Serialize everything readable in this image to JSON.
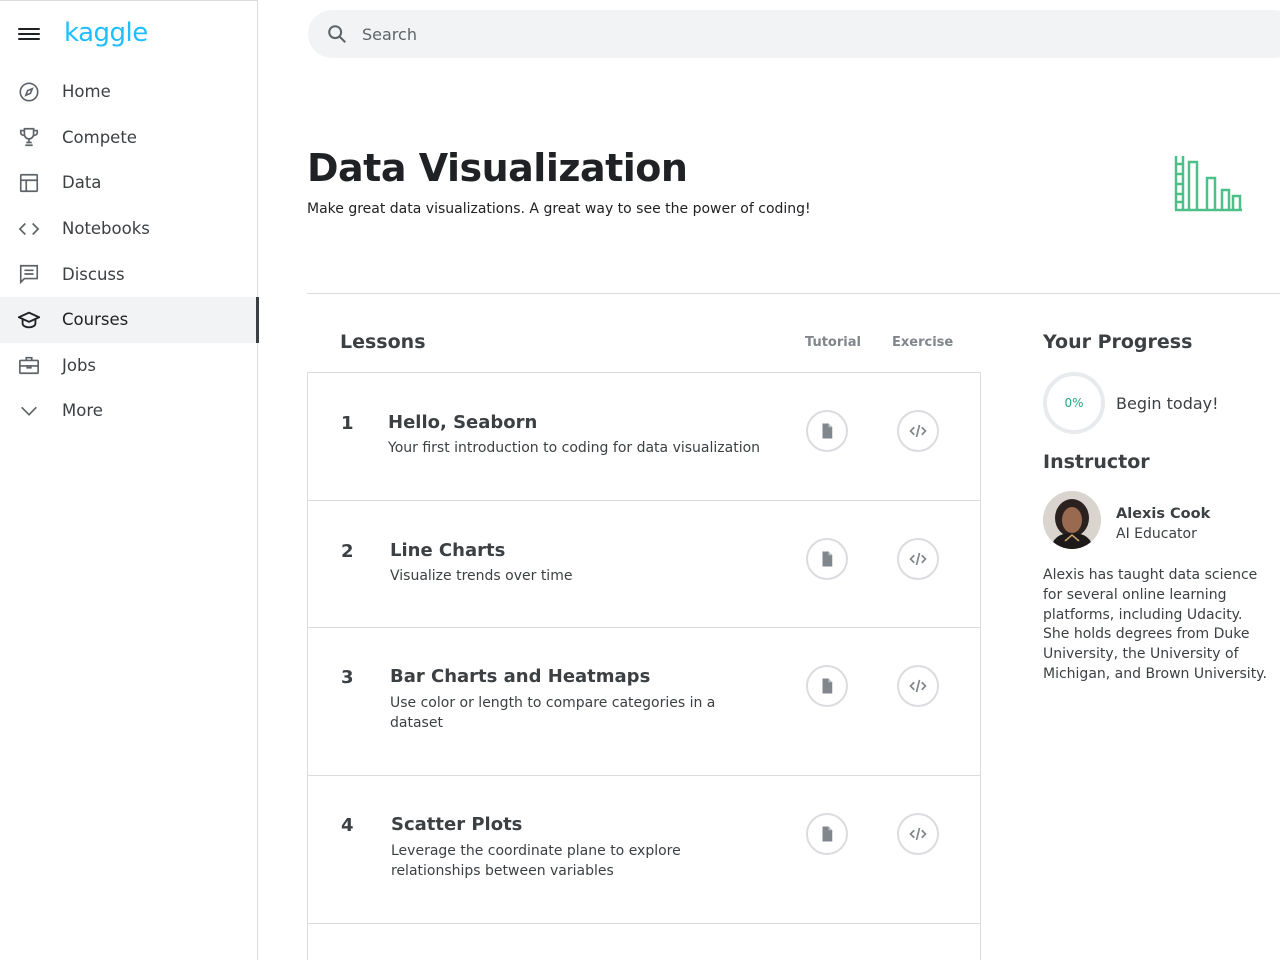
{
  "app": {
    "logo": "kaggle",
    "brand_color": "#20beff",
    "accent_green": "#20a779"
  },
  "sidebar": {
    "items": [
      {
        "label": "Home",
        "icon": "compass-icon",
        "active": false
      },
      {
        "label": "Compete",
        "icon": "trophy-icon",
        "active": false
      },
      {
        "label": "Data",
        "icon": "table-icon",
        "active": false
      },
      {
        "label": "Notebooks",
        "icon": "code-icon",
        "active": false
      },
      {
        "label": "Discuss",
        "icon": "comment-icon",
        "active": false
      },
      {
        "label": "Courses",
        "icon": "graduation-cap-icon",
        "active": true
      },
      {
        "label": "Jobs",
        "icon": "briefcase-icon",
        "active": false
      },
      {
        "label": "More",
        "icon": "chevron-down-icon",
        "active": false
      }
    ]
  },
  "search": {
    "placeholder": "Search",
    "value": ""
  },
  "course": {
    "title": "Data Visualization",
    "subtitle": "Make great data visualizations. A great way to see the power of coding!",
    "icon": "bar-chart-icon"
  },
  "lessons": {
    "heading": "Lessons",
    "tutorial_header": "Tutorial",
    "exercise_header": "Exercise",
    "rows": [
      {
        "number": "1",
        "name": "Hello, Seaborn",
        "description": "Your first introduction to coding for data visualization"
      },
      {
        "number": "2",
        "name": "Line Charts",
        "description": "Visualize trends over time"
      },
      {
        "number": "3",
        "name": "Bar Charts and Heatmaps",
        "description": "Use color or length to compare categories in a dataset"
      },
      {
        "number": "4",
        "name": "Scatter Plots",
        "description": "Leverage the coordinate plane to explore relationships between variables"
      }
    ]
  },
  "progress": {
    "heading": "Your Progress",
    "percent": "0%",
    "message": "Begin today!"
  },
  "instructor": {
    "heading": "Instructor",
    "name": "Alexis Cook",
    "role": "AI Educator",
    "bio": "Alexis has taught data science for several online learning platforms, including Udacity. She holds degrees from Duke University, the University of Michigan, and Brown University."
  }
}
